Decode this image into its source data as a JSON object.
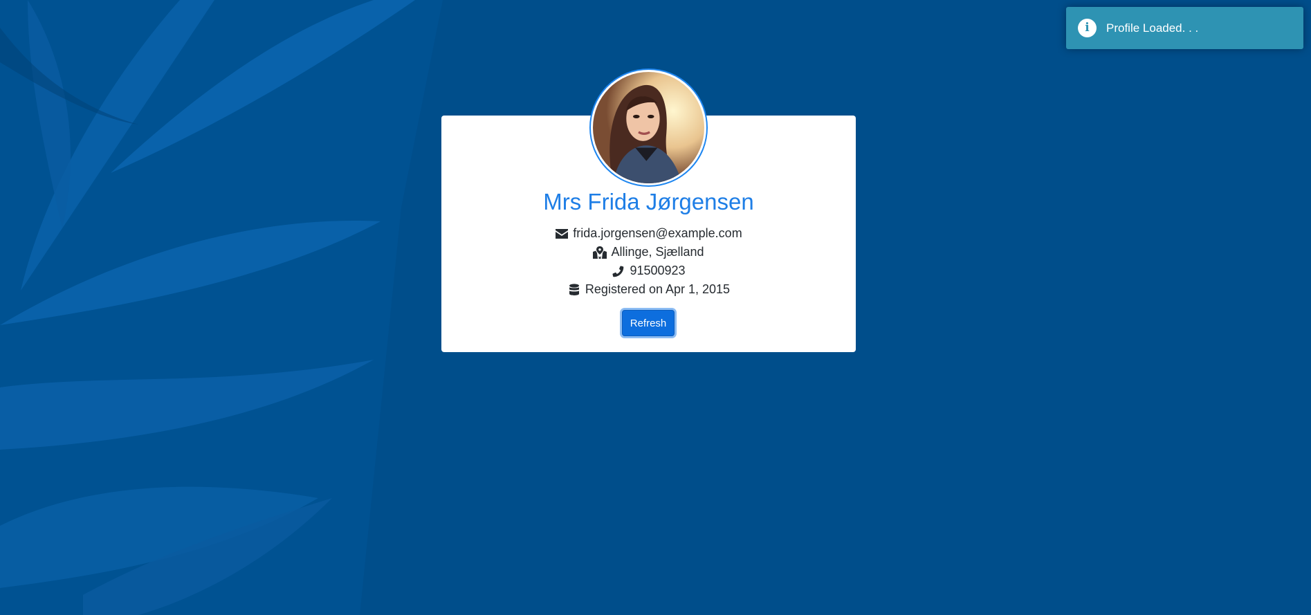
{
  "colors": {
    "background": "#004e8b",
    "card": "#ffffff",
    "name": "#1e7ee6",
    "button": "#0d6ede",
    "toast": "#2e93b3"
  },
  "profile": {
    "name": "Mrs Frida Jørgensen",
    "email": "frida.jorgensen@example.com",
    "location": "Allinge, Sjælland",
    "phone": "91500923",
    "registered": "Registered on Apr 1, 2015",
    "avatar_icon": "profile-photo"
  },
  "icons": {
    "email": "envelope-icon",
    "location": "map-marked-icon",
    "phone": "phone-icon",
    "registered": "database-icon",
    "toast": "info-icon"
  },
  "actions": {
    "refresh_label": "Refresh"
  },
  "toast": {
    "message": "Profile Loaded. . ."
  }
}
